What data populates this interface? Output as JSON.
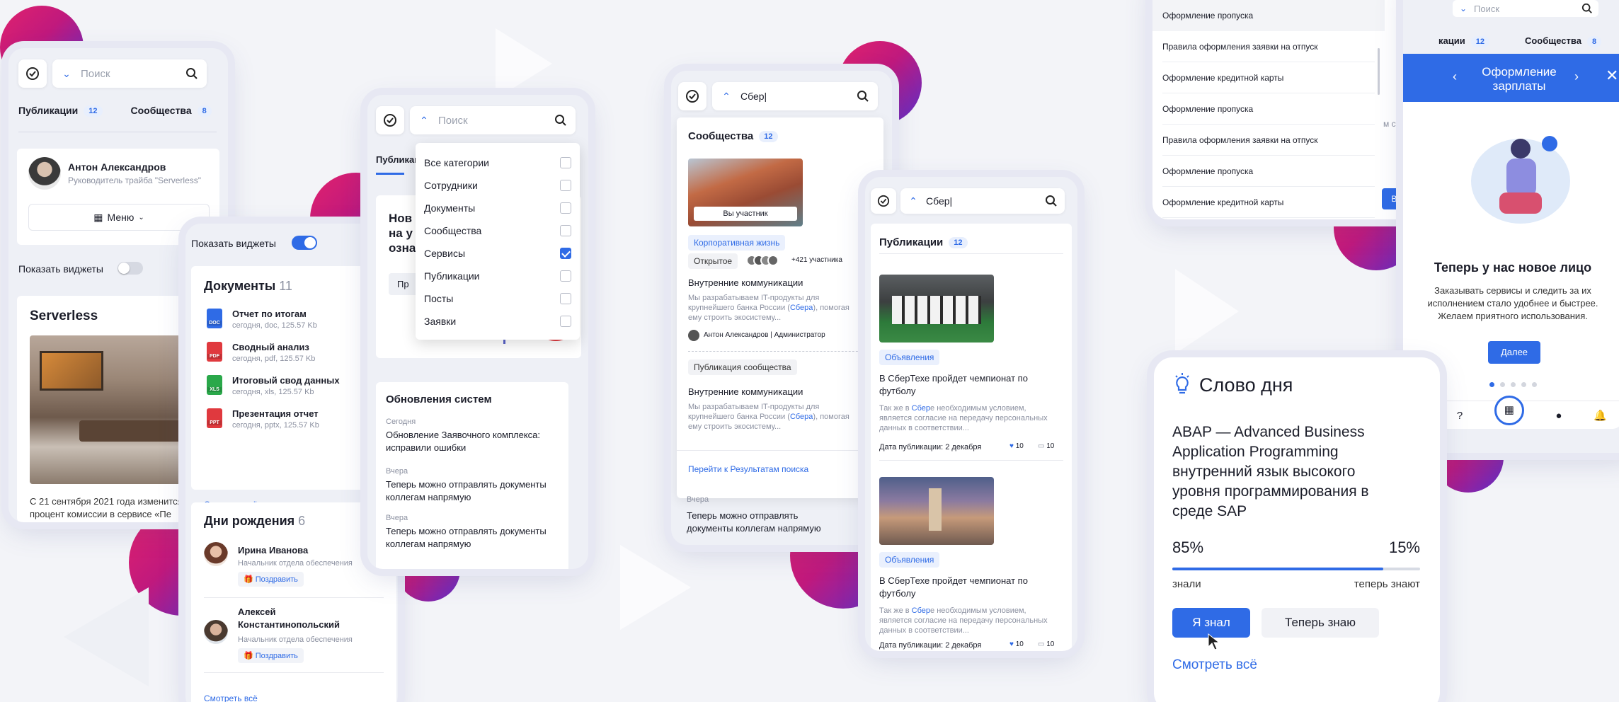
{
  "colors": {
    "accent": "#2f6be6",
    "blob": "#d61c74",
    "card_bg": "#ffffff",
    "page_bg": "#f3f4f8"
  },
  "common": {
    "search_placeholder": "Поиск"
  },
  "screen1": {
    "tabs": [
      {
        "label": "Публикации",
        "count": "12"
      },
      {
        "label": "Сообщества",
        "count": "8"
      }
    ],
    "profile": {
      "name": "Антон Александров",
      "role": "Руководитель трайба \"Serverless\""
    },
    "menu_label": "Меню",
    "widgets_label": "Показать виджеты",
    "section_title": "Serverless",
    "body_text": "С 21 сентября 2021 года изменится процент комиссии в сервисе «Пе"
  },
  "screen2": {
    "widgets_label": "Показать виджеты",
    "docs_title": "Документы",
    "docs_count": "11",
    "docs": [
      {
        "name": "Отчет по итогам",
        "meta": "сегодня, doc, 125.57 Kb",
        "ext": "DOC",
        "color": "#2f6be6"
      },
      {
        "name": "Сводный анализ",
        "meta": "сегодня, pdf, 125.57 Kb",
        "ext": "PDF",
        "color": "#e0393e"
      },
      {
        "name": "Итоговый свод данных",
        "meta": "сегодня, xls, 125.57 Kb",
        "ext": "XLS",
        "color": "#2aa84a"
      },
      {
        "name": "Презентация отчет",
        "meta": "сегодня, pptx, 125.57 Kb",
        "ext": "PPT",
        "color": "#e0393e"
      }
    ],
    "see_all": "Смотреть всё",
    "bday_title": "Дни рождения",
    "bday_count": "6",
    "people": [
      {
        "name": "Ирина Иванова",
        "role": "Начальник отдела обеспечения",
        "action": "Поздравить"
      },
      {
        "name": "Алексей Константинопольский",
        "role": "Начальник отдела обеспечения",
        "action": "Поздравить"
      }
    ],
    "see_all2": "Смотреть всё"
  },
  "screen3": {
    "tab": "Публикации",
    "dropdown": [
      {
        "label": "Все категории",
        "checked": false
      },
      {
        "label": "Сотрудники",
        "checked": false
      },
      {
        "label": "Документы",
        "checked": false
      },
      {
        "label": "Сообщества",
        "checked": false
      },
      {
        "label": "Сервисы",
        "checked": true
      },
      {
        "label": "Публикации",
        "checked": false
      },
      {
        "label": "Посты",
        "checked": false
      },
      {
        "label": "Заявки",
        "checked": false
      }
    ],
    "promo_lines": [
      "Нов",
      "на у",
      "озна"
    ],
    "promo_button": "Пр",
    "updates_title": "Обновления систем",
    "updates": [
      {
        "when": "Сегодня",
        "text": "Обновление Заявочного комплекса: исправили ошибки"
      },
      {
        "when": "Вчера",
        "text": "Теперь можно отправлять документы коллегам напрямую"
      },
      {
        "when": "Вчера",
        "text": "Теперь можно отправлять документы коллегам напрямую"
      }
    ]
  },
  "screen4": {
    "query": "Сбер|",
    "title": "Сообщества",
    "count": "12",
    "member_label": "Вы участник",
    "category": "Корпоративная жизнь",
    "status": "Открытое",
    "participants": "+421 участника",
    "post_title": "Внутренние коммуникации",
    "post_text_a": "Мы разрабатываем IT-продукты для крупнейшего банка России (",
    "post_hl": "Сбера",
    "post_text_b": "), помогая ему строить экосистему...",
    "author": "Антон Александров | Администратор",
    "pub_tag": "Публикация сообщества",
    "post2_title": "Внутренние коммуникации",
    "link": "Перейти к Результатам поиска",
    "under_when": "Вчера",
    "under_text": "Теперь можно отправлять документы коллегам напрямую"
  },
  "screen5": {
    "query": "Сбер|",
    "title": "Публикации",
    "count": "12",
    "posts": [
      {
        "tag": "Объявления",
        "title": "В СберТехе пройдет чемпионат по футболу",
        "text_a": "Так же в ",
        "hl": "Сбер",
        "text_b": "е необходимым условием, является согласие на передачу персональных данных в соответствии...",
        "date": "Дата публикации: 2 декабря",
        "likes": "10",
        "comments": "10"
      },
      {
        "tag": "Объявления",
        "title": "В СберТехе пройдет чемпионат по футболу",
        "text_a": "Так же в ",
        "hl": "Сбер",
        "text_b": "е необходимым условием, является согласие на передачу персональных данных в соответствии...",
        "date": "Дата публикации: 2 декабря",
        "likes": "10",
        "comments": "10"
      }
    ]
  },
  "screen6": {
    "items": [
      "Оформление пропуска",
      "Правила оформления заявки на отпуск",
      "Оформление кредитной карты",
      "Оформление пропуска",
      "Правила оформления заявки на отпуск",
      "Оформление пропуска",
      "Оформление кредитной карты"
    ]
  },
  "screen7": {
    "tabs": [
      {
        "label": "кации",
        "count": "12"
      },
      {
        "label": "Сообщества",
        "count": "8"
      }
    ],
    "peek_text": "м стало",
    "forward": "Вперед",
    "header": "Оформление зарплаты",
    "headline": "Теперь у нас новое лицо",
    "body": "Заказывать сервисы и следить за их исполнением стало удобнее и быстрее. Желаем приятного использования.",
    "next": "Далее"
  },
  "screen8": {
    "title": "Слово дня",
    "text": "ABAP — Advanced Business Application Programming внутренний язык высокого уровня программирования в среде SAP",
    "left_pct": "85%",
    "right_pct": "15%",
    "progress": 0.85,
    "left_label": "знали",
    "right_label": "теперь знают",
    "btn_knew": "Я знал",
    "btn_now": "Теперь знаю",
    "see_all": "Смотреть всё"
  }
}
